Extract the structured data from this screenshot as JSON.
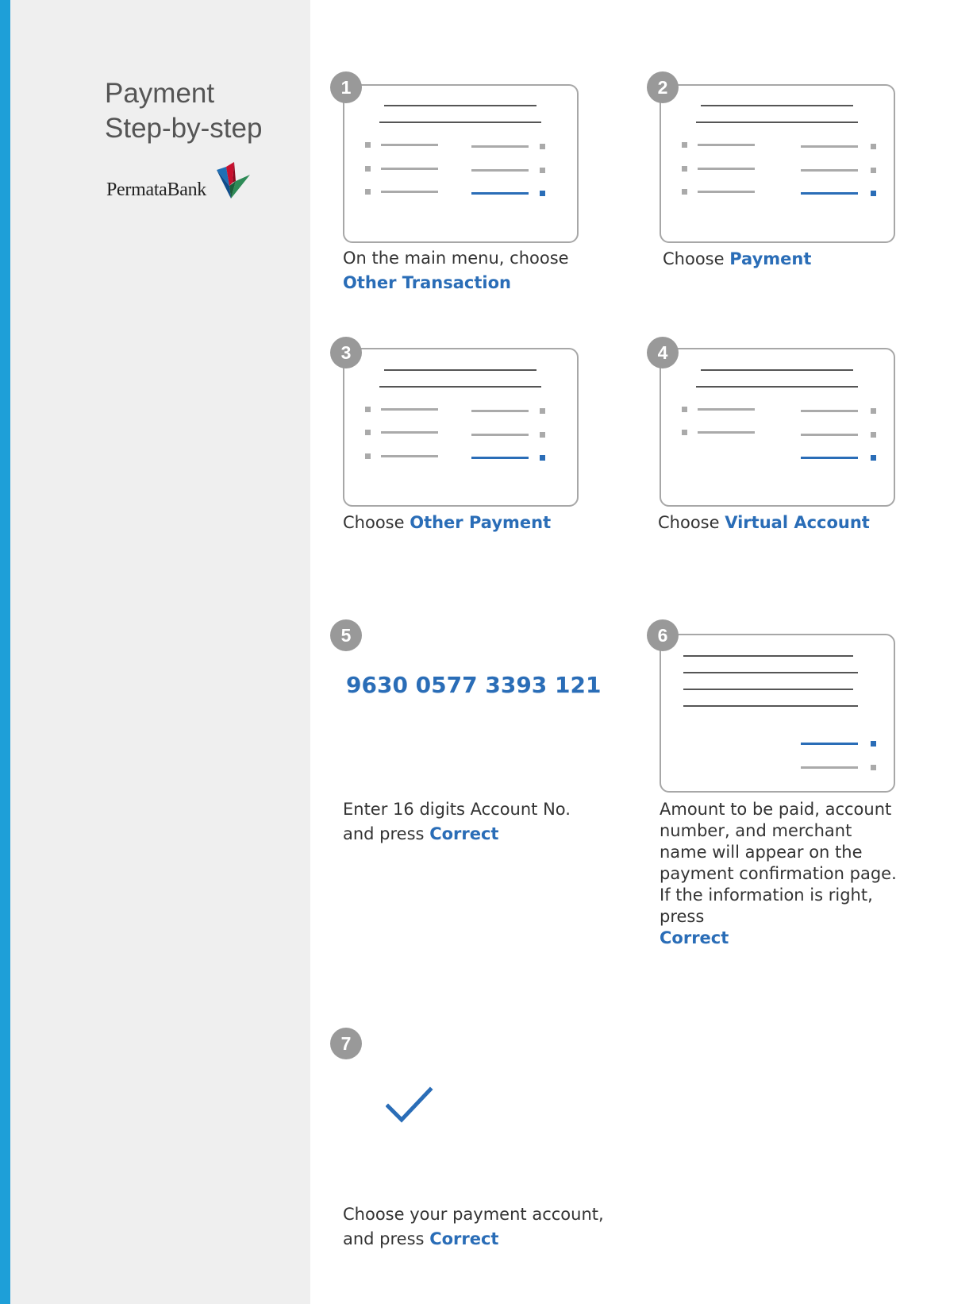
{
  "sidebar": {
    "title_line1": "Payment",
    "title_line2": "Step-by-step",
    "logo_text": "PermataBank"
  },
  "colors": {
    "accent_bar": "#1e9fd8",
    "sidebar_bg": "#efefef",
    "highlight_blue": "#2a6db7",
    "badge_grey": "#999999"
  },
  "steps": [
    {
      "number": "1",
      "text": "On the main menu, choose",
      "highlight": "Other Transaction"
    },
    {
      "number": "2",
      "text": "Choose",
      "highlight": "Payment"
    },
    {
      "number": "3",
      "text": "Choose",
      "highlight": "Other Payment"
    },
    {
      "number": "4",
      "text": "Choose",
      "highlight": "Virtual Account"
    },
    {
      "number": "5",
      "value": "9630 0577 3393 121",
      "text": "Enter 16 digits Account No.",
      "text2": "and press",
      "highlight": "Correct"
    },
    {
      "number": "6",
      "text": "Amount to be paid, account number, and merchant name will appear on the payment confirmation page. If the information is right, press",
      "highlight": "Correct"
    },
    {
      "number": "7",
      "text": "Choose your payment account,",
      "text2": "and press",
      "highlight": "Correct",
      "icon": "checkmark-icon"
    }
  ]
}
